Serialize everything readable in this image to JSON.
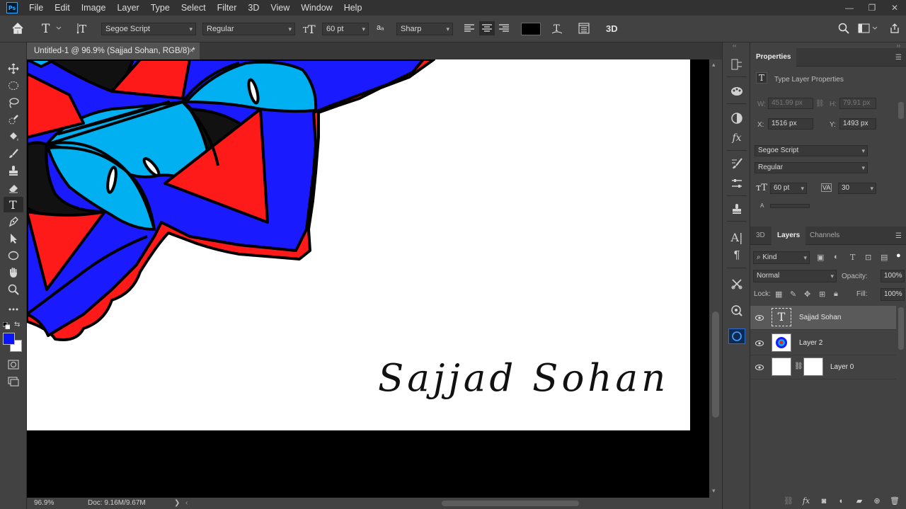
{
  "app": {
    "logo": "Ps",
    "menu": [
      "File",
      "Edit",
      "Image",
      "Layer",
      "Type",
      "Select",
      "Filter",
      "3D",
      "View",
      "Window",
      "Help"
    ],
    "window_controls": {
      "minimize": "—",
      "restore": "❐",
      "close": "✕"
    }
  },
  "options": {
    "font_family": "Segoe Script",
    "font_style": "Regular",
    "font_size": "60 pt",
    "antialias": "Sharp",
    "text_color": "#000000"
  },
  "document": {
    "tab_title": "Untitled-1 @ 96.9% (Sajjad Sohan, RGB/8) *",
    "tab_close": "×",
    "signature_text": "Sajjad Sohan",
    "zoom": "96.9%",
    "doc_info": "Doc: 9.16M/9.67M"
  },
  "colors": {
    "foreground": "#0a15ff",
    "background": "#ffffff",
    "mandala_blue": "#1a1aff",
    "mandala_cyan": "#00b0f0",
    "mandala_red": "#ff1a1a"
  },
  "properties": {
    "panel_title": "Properties",
    "type_label": "Type Layer Properties",
    "w_label": "W:",
    "w_value": "451.99 px",
    "h_label": "H:",
    "h_value": "79.91 px",
    "x_label": "X:",
    "x_value": "1516 px",
    "y_label": "Y:",
    "y_value": "1493 px",
    "font_family": "Segoe Script",
    "font_style": "Regular",
    "font_size": "60 pt",
    "tracking": "30"
  },
  "layers": {
    "tabs": [
      "3D",
      "Layers",
      "Channels"
    ],
    "filter": "Kind",
    "blend_mode": "Normal",
    "opacity_label": "Opacity:",
    "opacity": "100%",
    "lock_label": "Lock:",
    "fill_label": "Fill:",
    "fill": "100%",
    "items": [
      {
        "name": "Sajjad Sohan",
        "kind": "text"
      },
      {
        "name": "Layer 2",
        "kind": "image"
      },
      {
        "name": "Layer 0",
        "kind": "masked"
      }
    ]
  }
}
